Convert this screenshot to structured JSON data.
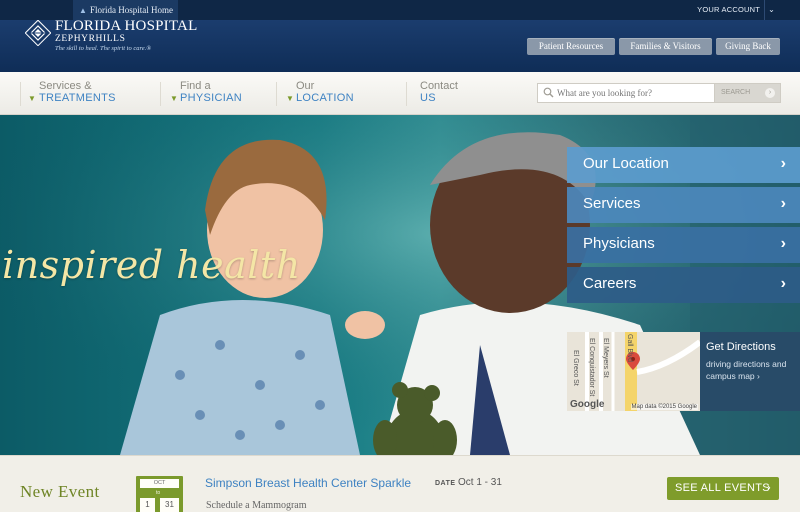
{
  "topbar": {
    "home_link": "Florida Hospital Home",
    "account_label": "YOUR ACCOUNT",
    "account_chevron": "⌄"
  },
  "logo": {
    "name": "FLORIDA HOSPITAL",
    "location": "ZEPHYRHILLS",
    "tagline": "The skill to heal. The spirit to care.®"
  },
  "header_buttons": [
    "Patient Resources",
    "Families & Visitors",
    "Giving Back"
  ],
  "nav": [
    {
      "line1": "Services &",
      "line2": "TREATMENTS"
    },
    {
      "line1": "Find a",
      "line2": "PHYSICIAN"
    },
    {
      "line1": "Our",
      "line2": "LOCATION"
    },
    {
      "line1": "Contact",
      "line2": "US"
    }
  ],
  "search": {
    "placeholder": "What are you looking for?",
    "button_label": "SEARCH"
  },
  "hero": {
    "tagline": "inspired health",
    "quick_links": [
      "Our Location",
      "Services",
      "Physicians",
      "Careers"
    ],
    "map": {
      "title": "Get Directions",
      "description": "driving directions and campus map ›",
      "attribution": "Map data ©2015 Google",
      "google": "Google",
      "streets": [
        "El Greco St",
        "El Conquistador St",
        "El Meyers St",
        "Gall Blvd"
      ]
    }
  },
  "events": {
    "heading": "New Event",
    "calendar": {
      "month": "OCT",
      "to": "to",
      "start_day": "1",
      "end_day": "31"
    },
    "title": "Simpson Breast Health Center Sparkle",
    "date_label": "DATE",
    "date": "Oct 1 - 31",
    "subtitle": "Schedule a Mammogram",
    "see_all": "SEE ALL EVENTS"
  },
  "colors": {
    "header_blue": "#0f2d57",
    "nav_link_blue": "#3f83c3",
    "event_green": "#7f9c2b",
    "hero_teal": "#157a82",
    "tagline_cream": "#f4e6a6"
  }
}
